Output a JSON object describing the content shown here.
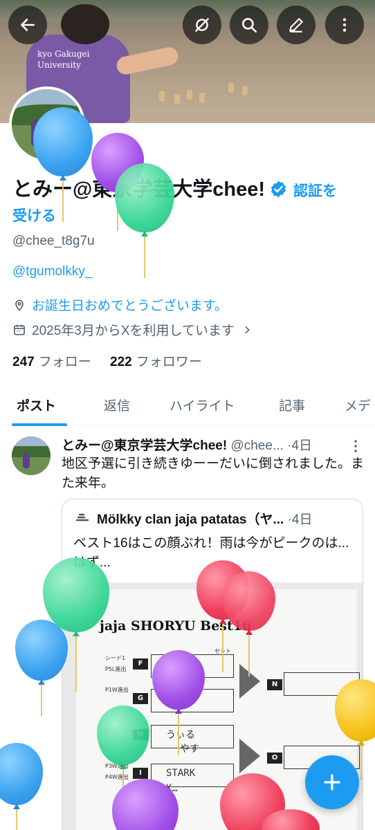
{
  "header": {
    "back_icon": "arrow-left-icon",
    "buttons": [
      "grok-icon",
      "search-icon",
      "edit-icon",
      "more-icon"
    ],
    "banner_text_line1": "kyo Gakugei",
    "banner_text_line2": "University"
  },
  "profile": {
    "display_name": "とみー@東京学芸大学chee!",
    "verify_link_line1": "認証を",
    "verify_link_line2": "受ける",
    "handle": "@chee_t8g7u",
    "bio_link": "@tgumolkky_",
    "birthday_text": "お誕生日おめでとうございます。",
    "joined_text": "2025年3月からXを利用しています",
    "following_count": "247",
    "following_label": "フォロー",
    "followers_count": "222",
    "followers_label": "フォロワー",
    "accent_color": "#1d9bf0"
  },
  "tabs": [
    {
      "label": "ポスト",
      "active": true
    },
    {
      "label": "返信",
      "active": false
    },
    {
      "label": "ハイライト",
      "active": false
    },
    {
      "label": "記事",
      "active": false
    },
    {
      "label": "メデ",
      "active": false
    }
  ],
  "post": {
    "author_name": "とみー@東京学芸大学chee!",
    "author_handle": "@chee...",
    "time": "·4日",
    "text": "地区予選に引き続きゆーーだいに倒されました。また来年。",
    "quote": {
      "author_name": "Mölkky clan jaja patatas（ヤ...",
      "time": "·4日",
      "text": "ベスト16はこの顔ぶれ！雨は今がピークのは...はず...",
      "image_title": "jaja SHORYU Best16",
      "image_labels": {
        "seed1": "シード1",
        "p5l": "P5L進出",
        "p1w": "P1W進出",
        "p3w": "P3W進出",
        "p4w": "P4W進出",
        "set": "セット"
      },
      "seeds": [
        "F",
        "G",
        "H",
        "I"
      ],
      "results": [
        "N",
        "O"
      ],
      "handwritten": [
        "もも",
        "ゆー",
        "うぃる",
        "やす",
        "STARK",
        "K…"
      ]
    }
  },
  "fab": {
    "icon": "plus-icon"
  }
}
